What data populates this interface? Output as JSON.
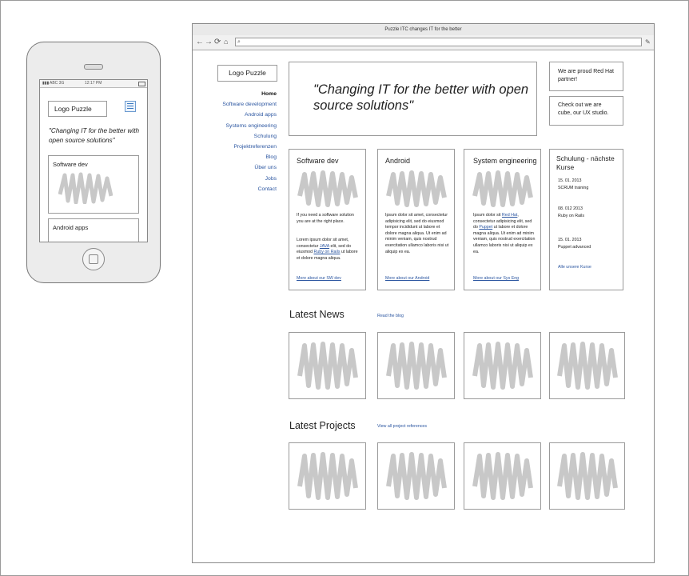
{
  "mobile": {
    "carrier": "ABC 3G",
    "time": "12:17 PM",
    "logo": "Logo Puzzle",
    "quote": "\"Changing IT for the better with open source solutions\"",
    "cards": [
      "Software dev",
      "Android apps"
    ]
  },
  "browser": {
    "title": "Puzzle ITC changes IT for the better",
    "address": ""
  },
  "site": {
    "logo": "Logo Puzzle",
    "nav": [
      {
        "label": "Home",
        "active": true
      },
      {
        "label": "Software development"
      },
      {
        "label": "Android apps"
      },
      {
        "label": "Systems engineering"
      },
      {
        "label": "Schulung"
      },
      {
        "label": "Projektreferenzen"
      },
      {
        "label": "Blog"
      },
      {
        "label": "Über uns"
      },
      {
        "label": "Jobs"
      },
      {
        "label": "Contact"
      }
    ],
    "hero": "\"Changing IT for the better with open source solutions\"",
    "promos": [
      "We are proud Red Hat partner!",
      "Check out we are cube, our UX studio."
    ],
    "services": [
      {
        "title": "Software dev",
        "p1": "If you need a software solution you are at the right place.",
        "p2_a": "Lorem ipsum dolor sit amet, consectetur ",
        "p2_link1": "JAVA",
        "p2_b": " elit, sed do eiusmod ",
        "p2_link2": "Ruby on Rails",
        "p2_c": " ut labore et dolore magna aliqua.",
        "more": "More about our SW dev"
      },
      {
        "title": "Android",
        "p1": "Ipsum dolor sit amet, consectetur adipisicing elit, sed do eiusmod tempor incididunt ut labore et dolore magna aliqua. Ut enim ad minim veniam, quis nostrud exercitation ullamco laboris nisi ut aliquip ex ea.",
        "more": "More about our Android"
      },
      {
        "title": "System engineering",
        "p1_a": "Ipsum dolor sit ",
        "p1_link1": "Red Hat",
        "p1_b": ", consectetur adipisicing elit, sed do ",
        "p1_link2": "Puppet",
        "p1_c": " ut labore et dolore magna aliqua. Ut enim ad minim veniam, quis nostrud exercitation ullamco laboris nisi ut aliquip ex ea.",
        "more": "More about our Sys Eng"
      }
    ],
    "courses": {
      "title": "Schulung - nächste Kurse",
      "items": [
        {
          "date": "15. 01. 2013",
          "name": "SCRUM training"
        },
        {
          "date": "08. 012 2013",
          "name": "Ruby on Rails"
        },
        {
          "date": "15. 01. 2013",
          "name": "Puppet advanced"
        }
      ],
      "all": "Alle unsere Kurse"
    },
    "news": {
      "title": "Latest News",
      "link": "Read the blog"
    },
    "projects": {
      "title": "Latest Projects",
      "link": "View all project references"
    }
  }
}
